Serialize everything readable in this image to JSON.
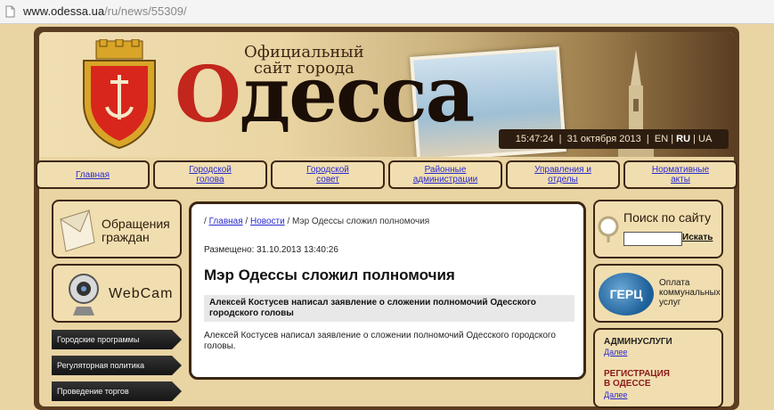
{
  "browser": {
    "url_domain": "www.odessa.ua",
    "url_path": "/ru/news/55309/"
  },
  "header": {
    "official_line1": "Официальный",
    "official_line2": "сайт города",
    "city_name_first": "О",
    "city_name_rest": "десса",
    "time": "15:47:24",
    "date": "31 октября 2013",
    "lang_en": "EN",
    "lang_ru": "RU",
    "lang_ua": "UA",
    "sep": "|"
  },
  "nav": {
    "items": [
      {
        "label_line1": "Главная",
        "label_line2": ""
      },
      {
        "label_line1": "Городской",
        "label_line2": "голова"
      },
      {
        "label_line1": "Городской",
        "label_line2": "совет"
      },
      {
        "label_line1": "Районные",
        "label_line2": "администрации"
      },
      {
        "label_line1": "Управления и",
        "label_line2": "отделы"
      },
      {
        "label_line1": "Нормативные",
        "label_line2": "акты"
      }
    ]
  },
  "left": {
    "appeals_line1": "Обращения",
    "appeals_line2": "граждан",
    "webcam": "WebCam",
    "menu": [
      "Городские программы",
      "Регуляторная политика",
      "Проведение торгов"
    ]
  },
  "main": {
    "breadcrumb_sep": "/",
    "breadcrumb_home": "Главная",
    "breadcrumb_news": "Новости",
    "breadcrumb_current": "Мэр Одессы сложил полномочия",
    "posted": "Размещено: 31.10.2013 13:40:26",
    "title": "Мэр Одессы сложил полномочия",
    "lead": "Алексей Костусев написал заявление о сложении полномочий Одесского городского головы",
    "body": "Алексей Костусев написал заявление о сложении полномочий Одесского городского головы."
  },
  "right": {
    "search_title": "Поиск по сайту",
    "search_value": "",
    "search_button": "Искать",
    "gerts_logo": "ГЕРЦ",
    "gerts_line1": "Оплата",
    "gerts_line2": "коммунальных",
    "gerts_line3": "услуг",
    "services": [
      {
        "title_line1": "АДМИНУСЛУГИ",
        "title_line2": "",
        "more": "Далее"
      },
      {
        "title_line1": "РЕГИСТРАЦИЯ",
        "title_line2": "В ОДЕССЕ",
        "more": "Далее"
      }
    ]
  },
  "colors": {
    "frame": "#5b3e22",
    "paper": "#e9d4a3",
    "link": "#2a2acf",
    "accent_red": "#c2261c"
  }
}
